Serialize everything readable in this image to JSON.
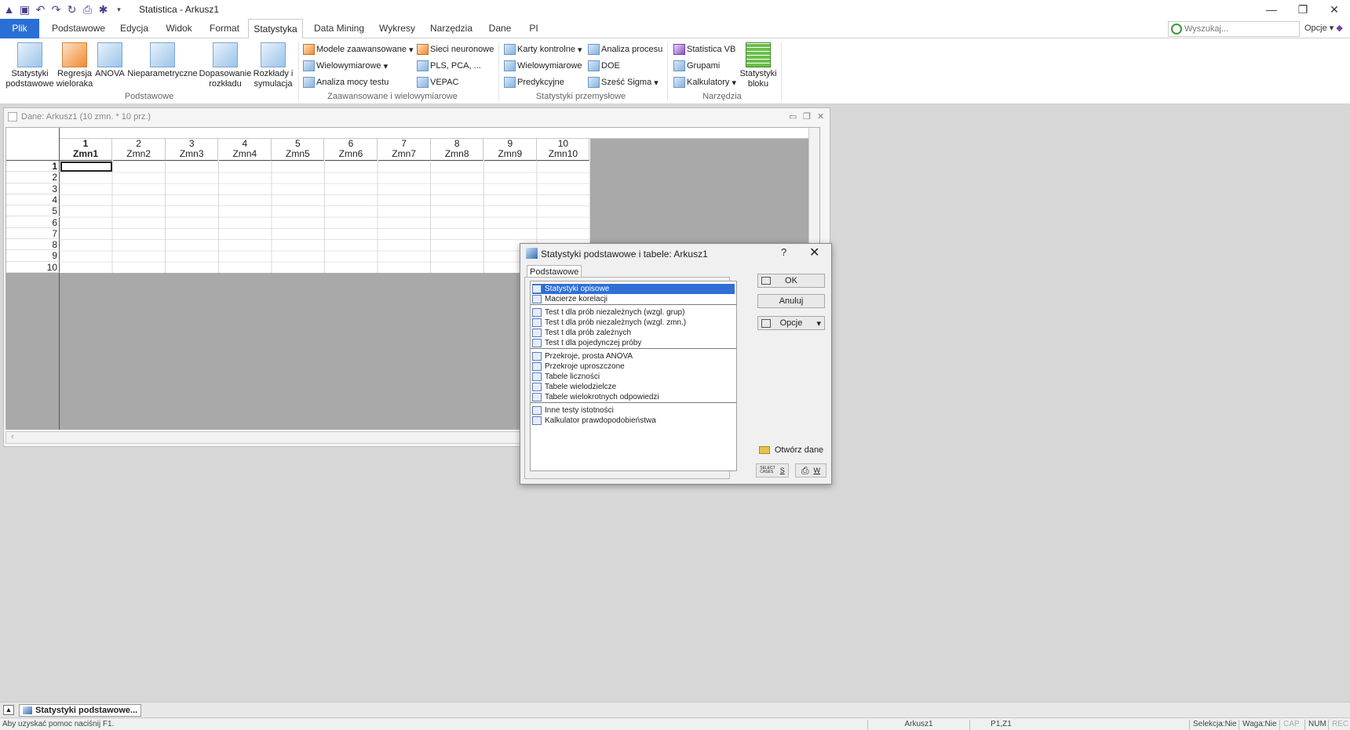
{
  "app": {
    "title": "Statistica - Arkusz1"
  },
  "tabs": [
    "Plik",
    "Podstawowe",
    "Edycja",
    "Widok",
    "Format",
    "Statystyka",
    "Data Mining",
    "Wykresy",
    "Narzędzia",
    "Dane",
    "PI"
  ],
  "active_tab": "Statystyka",
  "search": {
    "placeholder": "Wyszukaj..."
  },
  "options_top": "Opcje",
  "ribbon": {
    "big_buttons": [
      {
        "label": "Statystyki\npodstawowe"
      },
      {
        "label": "Regresja\nwieloraka"
      },
      {
        "label": "ANOVA"
      },
      {
        "label": "Nieparametryczne"
      },
      {
        "label": "Dopasowanie\nrozkładu"
      },
      {
        "label": "Rozkłady i\nsymulacja"
      }
    ],
    "groups": {
      "podstawowe": "Podstawowe",
      "zaawansowane": "Zaawansowane i wielowymiarowe",
      "przemyslowe": "Statystyki przemysłowe",
      "narzedzia": "Narzędzia"
    },
    "small_buttons": {
      "modele": "Modele zaawansowane",
      "wielowymiarowe": "Wielowymiarowe",
      "analiza_mocy": "Analiza mocy testu",
      "sieci": "Sieci neuronowe",
      "pls": "PLS, PCA, ...",
      "vepac": "VEPAC",
      "karty": "Karty kontrolne",
      "wielowymiarowe2": "Wielowymiarowe",
      "predykcyjne": "Predykcyjne",
      "analiza_procesu": "Analiza procesu",
      "doe": "DOE",
      "szesc_sigma": "Sześć Sigma",
      "statistica_vb": "Statistica VB",
      "grupami": "Grupami",
      "kalkulatory": "Kalkulatory",
      "statystyki_bloku": "Statystyki\nbloku"
    }
  },
  "sheet": {
    "title": "Dane: Arkusz1 (10 zmn. * 10 prz.)",
    "columns": [
      {
        "num": "1",
        "name": "Zmn1"
      },
      {
        "num": "2",
        "name": "Zmn2"
      },
      {
        "num": "3",
        "name": "Zmn3"
      },
      {
        "num": "4",
        "name": "Zmn4"
      },
      {
        "num": "5",
        "name": "Zmn5"
      },
      {
        "num": "6",
        "name": "Zmn6"
      },
      {
        "num": "7",
        "name": "Zmn7"
      },
      {
        "num": "8",
        "name": "Zmn8"
      },
      {
        "num": "9",
        "name": "Zmn9"
      },
      {
        "num": "10",
        "name": "Zmn10"
      }
    ],
    "rows": [
      "1",
      "2",
      "3",
      "4",
      "5",
      "6",
      "7",
      "8",
      "9",
      "10"
    ]
  },
  "dialog": {
    "title": "Statystyki podstawowe i tabele: Arkusz1",
    "help": "?",
    "tab": "Podstawowe",
    "items": [
      "Statystyki opisowe",
      "Macierze korelacji",
      "Test t dla prób niezależnych (wzgl. grup)",
      "Test t dla prób niezależnych (wzgl. zmn.)",
      "Test t dla prób zależnych",
      "Test t dla pojedynczej próby",
      "Przekroje, prosta ANOVA",
      "Przekroje uproszczone",
      "Tabele liczności",
      "Tabele wielodzielcze",
      "Tabele wielokrotnych odpowiedzi",
      "Inne testy istotności",
      "Kalkulator prawdopodobieństwa"
    ],
    "selected_index": 0,
    "buttons": {
      "ok": "OK",
      "cancel": "Anuluj",
      "options": "Opcje",
      "open_data": "Otwórz dane",
      "s": "S",
      "w": "W",
      "select_cases": "SELECT\nCASES"
    }
  },
  "taskbar": {
    "item": "Statystyki podstawowe..."
  },
  "status": {
    "help": "Aby uzyskać pomoc naciśnij F1.",
    "sheet": "Arkusz1",
    "cell": "P1,Z1",
    "selection": "Selekcja:Nie",
    "weight": "Waga:Nie",
    "cap": "CAP",
    "num": "NUM",
    "rec": "REC"
  }
}
